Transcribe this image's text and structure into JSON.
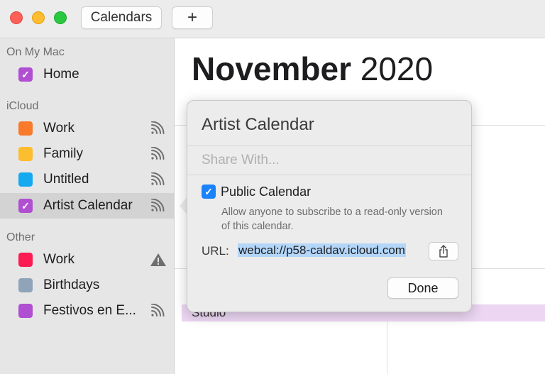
{
  "toolbar": {
    "calendars_label": "Calendars",
    "add_label": "+"
  },
  "sidebar": {
    "sections": [
      {
        "title": "On My Mac",
        "items": [
          {
            "label": "Home",
            "color": "#b04fd1",
            "checked": true,
            "icon": "none"
          }
        ]
      },
      {
        "title": "iCloud",
        "items": [
          {
            "label": "Work",
            "color": "#f97a2b",
            "checked": false,
            "icon": "broadcast-icon"
          },
          {
            "label": "Family",
            "color": "#fcbd2e",
            "checked": false,
            "icon": "broadcast-icon"
          },
          {
            "label": "Untitled",
            "color": "#15a9f0",
            "checked": false,
            "icon": "broadcast-icon"
          },
          {
            "label": "Artist Calendar",
            "color": "#b04fd1",
            "checked": true,
            "selected": true,
            "icon": "broadcast-icon"
          }
        ]
      },
      {
        "title": "Other",
        "items": [
          {
            "label": "Work",
            "color": "#fb1c52",
            "checked": false,
            "icon": "warning-icon"
          },
          {
            "label": "Birthdays",
            "color": "#8fa4b8",
            "checked": false,
            "icon": "none"
          },
          {
            "label": "Festivos en E...",
            "color": "#b04fd1",
            "checked": false,
            "icon": "broadcast-icon"
          }
        ]
      }
    ]
  },
  "main": {
    "month": "November",
    "year": "2020",
    "event_label": "Studio"
  },
  "popover": {
    "title": "Artist Calendar",
    "share_placeholder": "Share With...",
    "public_label": "Public Calendar",
    "public_checked": true,
    "public_desc": "Allow anyone to subscribe to a read-only version of this calendar.",
    "url_label": "URL:",
    "url_value": "webcal://p58-caldav.icloud.com",
    "done_label": "Done"
  },
  "colors": {
    "accent": "#1a82fb",
    "selection": "#b3d6f9"
  }
}
